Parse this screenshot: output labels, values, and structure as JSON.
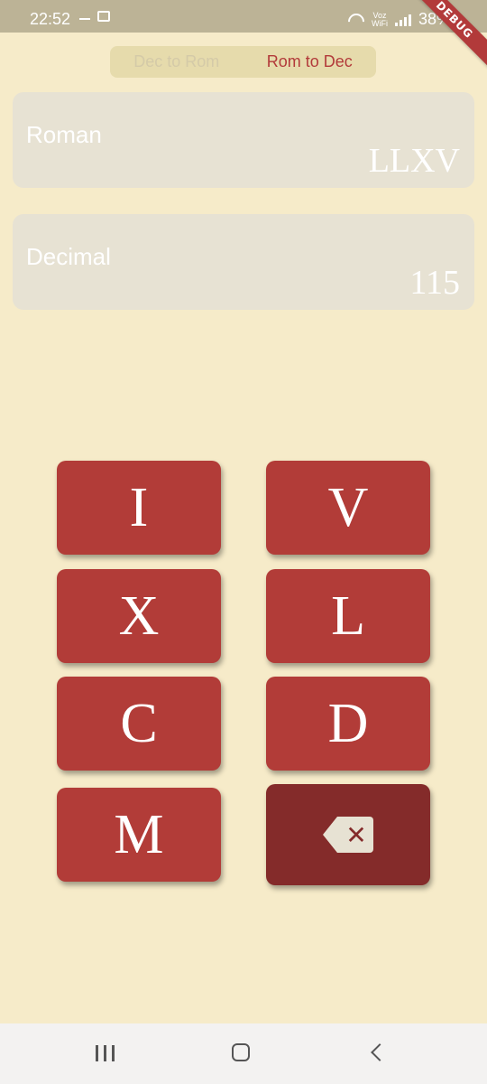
{
  "status_bar": {
    "time": "22:52",
    "network_label": "Voz\nWiFi",
    "battery": "38%"
  },
  "debug_banner": "DEBUG",
  "mode_toggle": {
    "options": [
      "Dec to Rom",
      "Rom to Dec"
    ],
    "selected": "Rom to Dec"
  },
  "fields": {
    "roman": {
      "label": "Roman",
      "value": "LLXV"
    },
    "decimal": {
      "label": "Decimal",
      "value": "115"
    }
  },
  "keypad": {
    "keys": [
      "I",
      "V",
      "X",
      "L",
      "C",
      "D",
      "M"
    ],
    "backspace_icon": "backspace-icon"
  },
  "colors": {
    "background": "#f6ebc9",
    "key": "#b23c38",
    "backspace_key": "#842b2a",
    "accent": "#b23a3a"
  },
  "navigation_bar": {
    "icons": [
      "recent-apps-icon",
      "home-icon",
      "back-icon"
    ]
  }
}
